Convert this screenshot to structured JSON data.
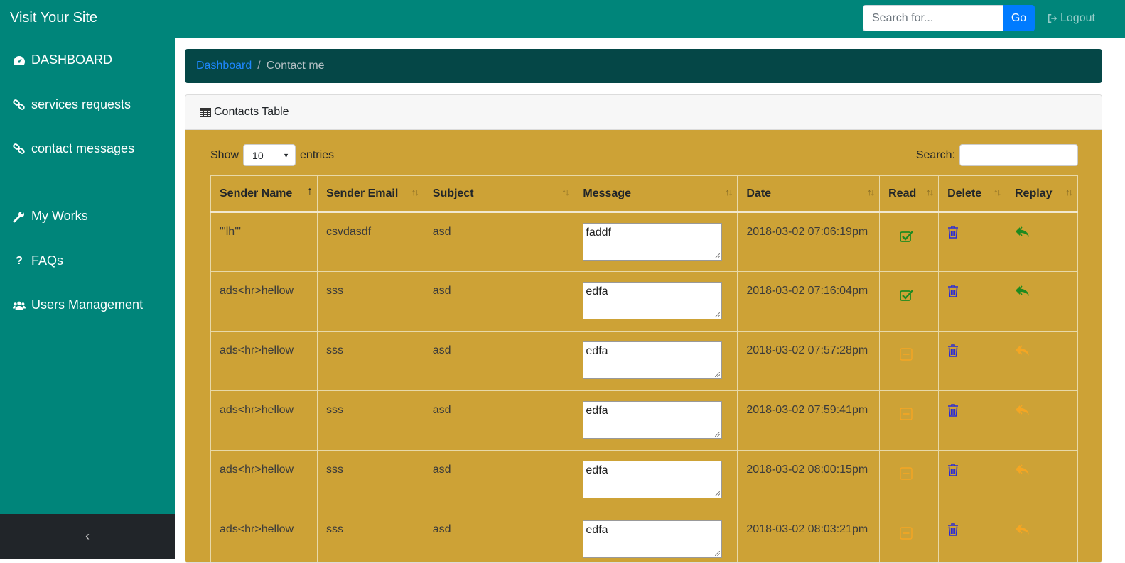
{
  "header": {
    "brand": "Visit Your Site",
    "search_placeholder": "Search for...",
    "go_label": "Go",
    "logout_label": "Logout"
  },
  "sidebar": {
    "items": [
      {
        "label": "DASHBOARD",
        "icon": "dashboard-icon"
      },
      {
        "label": "services requests",
        "icon": "link-icon"
      },
      {
        "label": "contact messages",
        "icon": "link-icon"
      },
      {
        "label": "My Works",
        "icon": "wrench-icon"
      },
      {
        "label": "FAQs",
        "icon": "question-icon"
      },
      {
        "label": "Users Management",
        "icon": "users-icon"
      }
    ],
    "collapse_label": "‹"
  },
  "breadcrumb": {
    "link": "Dashboard",
    "separator": "/",
    "current": "Contact me"
  },
  "card": {
    "title": "Contacts Table",
    "show_label": "Show",
    "entries_value": "10",
    "entries_label": "entries",
    "search_label": "Search:"
  },
  "table": {
    "columns": [
      "Sender Name",
      "Sender Email",
      "Subject",
      "Message",
      "Date",
      "Read",
      "Delete",
      "Replay"
    ],
    "rows": [
      {
        "name": "\"'lh'\"",
        "email": "csvdasdf",
        "subject": "asd",
        "message": "faddf",
        "date": "2018-03-02 07:06:19pm",
        "read": true
      },
      {
        "name": "ads<hr>hellow",
        "email": "sss",
        "subject": "asd",
        "message": "edfa",
        "date": "2018-03-02 07:16:04pm",
        "read": true
      },
      {
        "name": "ads<hr>hellow",
        "email": "sss",
        "subject": "asd",
        "message": "edfa",
        "date": "2018-03-02 07:57:28pm",
        "read": false
      },
      {
        "name": "ads<hr>hellow",
        "email": "sss",
        "subject": "asd",
        "message": "edfa",
        "date": "2018-03-02 07:59:41pm",
        "read": false
      },
      {
        "name": "ads<hr>hellow",
        "email": "sss",
        "subject": "asd",
        "message": "edfa",
        "date": "2018-03-02 08:00:15pm",
        "read": false
      },
      {
        "name": "ads<hr>hellow",
        "email": "sss",
        "subject": "asd",
        "message": "edfa",
        "date": "2018-03-02 08:03:21pm",
        "read": false
      }
    ]
  },
  "colors": {
    "teal": "#00857a",
    "dark_teal": "#054747",
    "gold": "#cda236",
    "read_green": "#1f8a1f",
    "unread_orange": "#f5a623",
    "delete_blue": "#2a2ad6"
  }
}
